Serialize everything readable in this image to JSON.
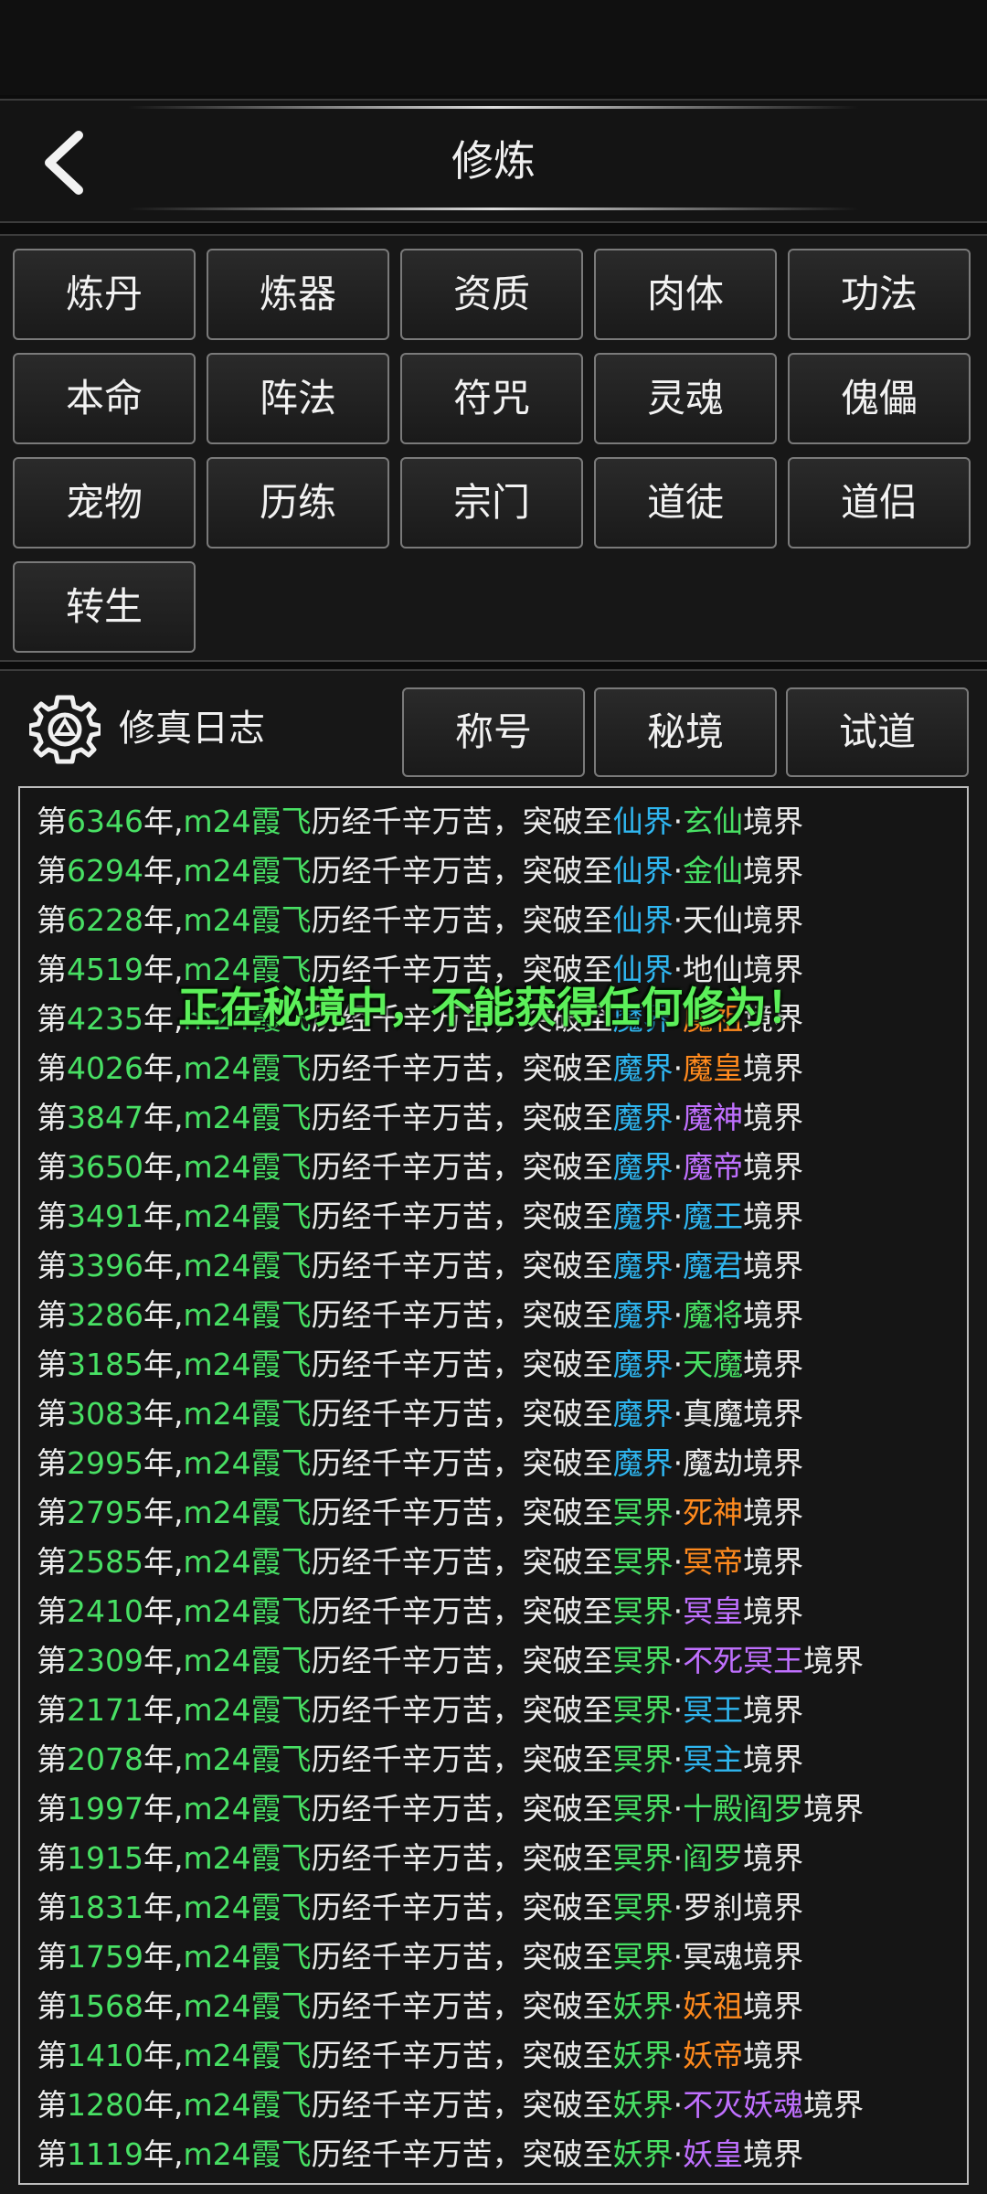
{
  "header": {
    "title": "修炼"
  },
  "menu": {
    "buttons": [
      "炼丹",
      "炼器",
      "资质",
      "肉体",
      "功法",
      "本命",
      "阵法",
      "符咒",
      "灵魂",
      "傀儡",
      "宠物",
      "历练",
      "宗门",
      "道徒",
      "道侣",
      "转生"
    ]
  },
  "log": {
    "title": "修真日志",
    "tabs": [
      "称号",
      "秘境",
      "试道"
    ],
    "entries": [
      {
        "prefix": "第",
        "year": "6346",
        "mid": "年,",
        "name": "m24霞飞",
        "text": "历经千辛万苦，突破至",
        "realm": "仙界",
        "dot": "·",
        "stage": "玄仙",
        "suffix": "境界",
        "stage_color": "#48e064"
      },
      {
        "prefix": "第",
        "year": "6294",
        "mid": "年,",
        "name": "m24霞飞",
        "text": "历经千辛万苦，突破至",
        "realm": "仙界",
        "dot": "·",
        "stage": "金仙",
        "suffix": "境界",
        "stage_color": "#48e064"
      },
      {
        "prefix": "第",
        "year": "6228",
        "mid": "年,",
        "name": "m24霞飞",
        "text": "历经千辛万苦，突破至",
        "realm": "仙界",
        "dot": "·",
        "stage": "天仙",
        "suffix": "境界",
        "stage_color": "#ececec"
      },
      {
        "prefix": "第",
        "year": "4519",
        "mid": "年,",
        "name": "m24霞飞",
        "text": "历经千辛万苦，突破至",
        "realm": "仙界",
        "dot": "·",
        "stage": "地仙",
        "suffix": "境界",
        "stage_color": "#ececec"
      },
      {
        "prefix": "第",
        "year": "4235",
        "mid": "年,",
        "name": "m24霞飞",
        "text": "历经千辛万苦，突破至",
        "realm": "魔界",
        "dot": "·",
        "stage": "魔祖",
        "suffix": "境界",
        "stage_color": "#ff8a1e"
      },
      {
        "prefix": "第",
        "year": "4026",
        "mid": "年,",
        "name": "m24霞飞",
        "text": "历经千辛万苦，突破至",
        "realm": "魔界",
        "dot": "·",
        "stage": "魔皇",
        "suffix": "境界",
        "stage_color": "#ff8a1e"
      },
      {
        "prefix": "第",
        "year": "3847",
        "mid": "年,",
        "name": "m24霞飞",
        "text": "历经千辛万苦，突破至",
        "realm": "魔界",
        "dot": "·",
        "stage": "魔神",
        "suffix": "境界",
        "stage_color": "#c070ff"
      },
      {
        "prefix": "第",
        "year": "3650",
        "mid": "年,",
        "name": "m24霞飞",
        "text": "历经千辛万苦，突破至",
        "realm": "魔界",
        "dot": "·",
        "stage": "魔帝",
        "suffix": "境界",
        "stage_color": "#c070ff"
      },
      {
        "prefix": "第",
        "year": "3491",
        "mid": "年,",
        "name": "m24霞飞",
        "text": "历经千辛万苦，突破至",
        "realm": "魔界",
        "dot": "·",
        "stage": "魔王",
        "suffix": "境界",
        "stage_color": "#2fb6f0"
      },
      {
        "prefix": "第",
        "year": "3396",
        "mid": "年,",
        "name": "m24霞飞",
        "text": "历经千辛万苦，突破至",
        "realm": "魔界",
        "dot": "·",
        "stage": "魔君",
        "suffix": "境界",
        "stage_color": "#2fb6f0"
      },
      {
        "prefix": "第",
        "year": "3286",
        "mid": "年,",
        "name": "m24霞飞",
        "text": "历经千辛万苦，突破至",
        "realm": "魔界",
        "dot": "·",
        "stage": "魔将",
        "suffix": "境界",
        "stage_color": "#48e064"
      },
      {
        "prefix": "第",
        "year": "3185",
        "mid": "年,",
        "name": "m24霞飞",
        "text": "历经千辛万苦，突破至",
        "realm": "魔界",
        "dot": "·",
        "stage": "天魔",
        "suffix": "境界",
        "stage_color": "#48e064"
      },
      {
        "prefix": "第",
        "year": "3083",
        "mid": "年,",
        "name": "m24霞飞",
        "text": "历经千辛万苦，突破至",
        "realm": "魔界",
        "dot": "·",
        "stage": "真魔",
        "suffix": "境界",
        "stage_color": "#ececec"
      },
      {
        "prefix": "第",
        "year": "2995",
        "mid": "年,",
        "name": "m24霞飞",
        "text": "历经千辛万苦，突破至",
        "realm": "魔界",
        "dot": "·",
        "stage": "魔劫",
        "suffix": "境界",
        "stage_color": "#ececec"
      },
      {
        "prefix": "第",
        "year": "2795",
        "mid": "年,",
        "name": "m24霞飞",
        "text": "历经千辛万苦，突破至",
        "realm": "冥界",
        "dot": "·",
        "stage": "死神",
        "suffix": "境界",
        "stage_color": "#ff8a1e"
      },
      {
        "prefix": "第",
        "year": "2585",
        "mid": "年,",
        "name": "m24霞飞",
        "text": "历经千辛万苦，突破至",
        "realm": "冥界",
        "dot": "·",
        "stage": "冥帝",
        "suffix": "境界",
        "stage_color": "#ff8a1e"
      },
      {
        "prefix": "第",
        "year": "2410",
        "mid": "年,",
        "name": "m24霞飞",
        "text": "历经千辛万苦，突破至",
        "realm": "冥界",
        "dot": "·",
        "stage": "冥皇",
        "suffix": "境界",
        "stage_color": "#c070ff"
      },
      {
        "prefix": "第",
        "year": "2309",
        "mid": "年,",
        "name": "m24霞飞",
        "text": "历经千辛万苦，突破至",
        "realm": "冥界",
        "dot": "·",
        "stage": "不死冥王",
        "suffix": "境界",
        "stage_color": "#c070ff"
      },
      {
        "prefix": "第",
        "year": "2171",
        "mid": "年,",
        "name": "m24霞飞",
        "text": "历经千辛万苦，突破至",
        "realm": "冥界",
        "dot": "·",
        "stage": "冥王",
        "suffix": "境界",
        "stage_color": "#2fb6f0"
      },
      {
        "prefix": "第",
        "year": "2078",
        "mid": "年,",
        "name": "m24霞飞",
        "text": "历经千辛万苦，突破至",
        "realm": "冥界",
        "dot": "·",
        "stage": "冥主",
        "suffix": "境界",
        "stage_color": "#2fb6f0"
      },
      {
        "prefix": "第",
        "year": "1997",
        "mid": "年,",
        "name": "m24霞飞",
        "text": "历经千辛万苦，突破至",
        "realm": "冥界",
        "dot": "·",
        "stage": "十殿阎罗",
        "suffix": "境界",
        "stage_color": "#48e064"
      },
      {
        "prefix": "第",
        "year": "1915",
        "mid": "年,",
        "name": "m24霞飞",
        "text": "历经千辛万苦，突破至",
        "realm": "冥界",
        "dot": "·",
        "stage": "阎罗",
        "suffix": "境界",
        "stage_color": "#48e064"
      },
      {
        "prefix": "第",
        "year": "1831",
        "mid": "年,",
        "name": "m24霞飞",
        "text": "历经千辛万苦，突破至",
        "realm": "冥界",
        "dot": "·",
        "stage": "罗刹",
        "suffix": "境界",
        "stage_color": "#ececec"
      },
      {
        "prefix": "第",
        "year": "1759",
        "mid": "年,",
        "name": "m24霞飞",
        "text": "历经千辛万苦，突破至",
        "realm": "冥界",
        "dot": "·",
        "stage": "冥魂",
        "suffix": "境界",
        "stage_color": "#ececec"
      },
      {
        "prefix": "第",
        "year": "1568",
        "mid": "年,",
        "name": "m24霞飞",
        "text": "历经千辛万苦，突破至",
        "realm": "妖界",
        "dot": "·",
        "stage": "妖祖",
        "suffix": "境界",
        "stage_color": "#ff8a1e"
      },
      {
        "prefix": "第",
        "year": "1410",
        "mid": "年,",
        "name": "m24霞飞",
        "text": "历经千辛万苦，突破至",
        "realm": "妖界",
        "dot": "·",
        "stage": "妖帝",
        "suffix": "境界",
        "stage_color": "#ff8a1e"
      },
      {
        "prefix": "第",
        "year": "1280",
        "mid": "年,",
        "name": "m24霞飞",
        "text": "历经千辛万苦，突破至",
        "realm": "妖界",
        "dot": "·",
        "stage": "不灭妖魂",
        "suffix": "境界",
        "stage_color": "#c070ff"
      },
      {
        "prefix": "第",
        "year": "1119",
        "mid": "年,",
        "name": "m24霞飞",
        "text": "历经千辛万苦，突破至",
        "realm": "妖界",
        "dot": "·",
        "stage": "妖皇",
        "suffix": "境界",
        "stage_color": "#c070ff"
      }
    ],
    "realm_colors": {
      "仙界": "#2fb6f0",
      "魔界": "#2fb6f0",
      "冥界": "#48e064",
      "妖界": "#48e064"
    }
  },
  "toast": {
    "message": "正在秘境中，不能获得任何修为！"
  },
  "colors": {
    "year": "#48e064",
    "name": "#48e064",
    "text": "#ececec"
  }
}
